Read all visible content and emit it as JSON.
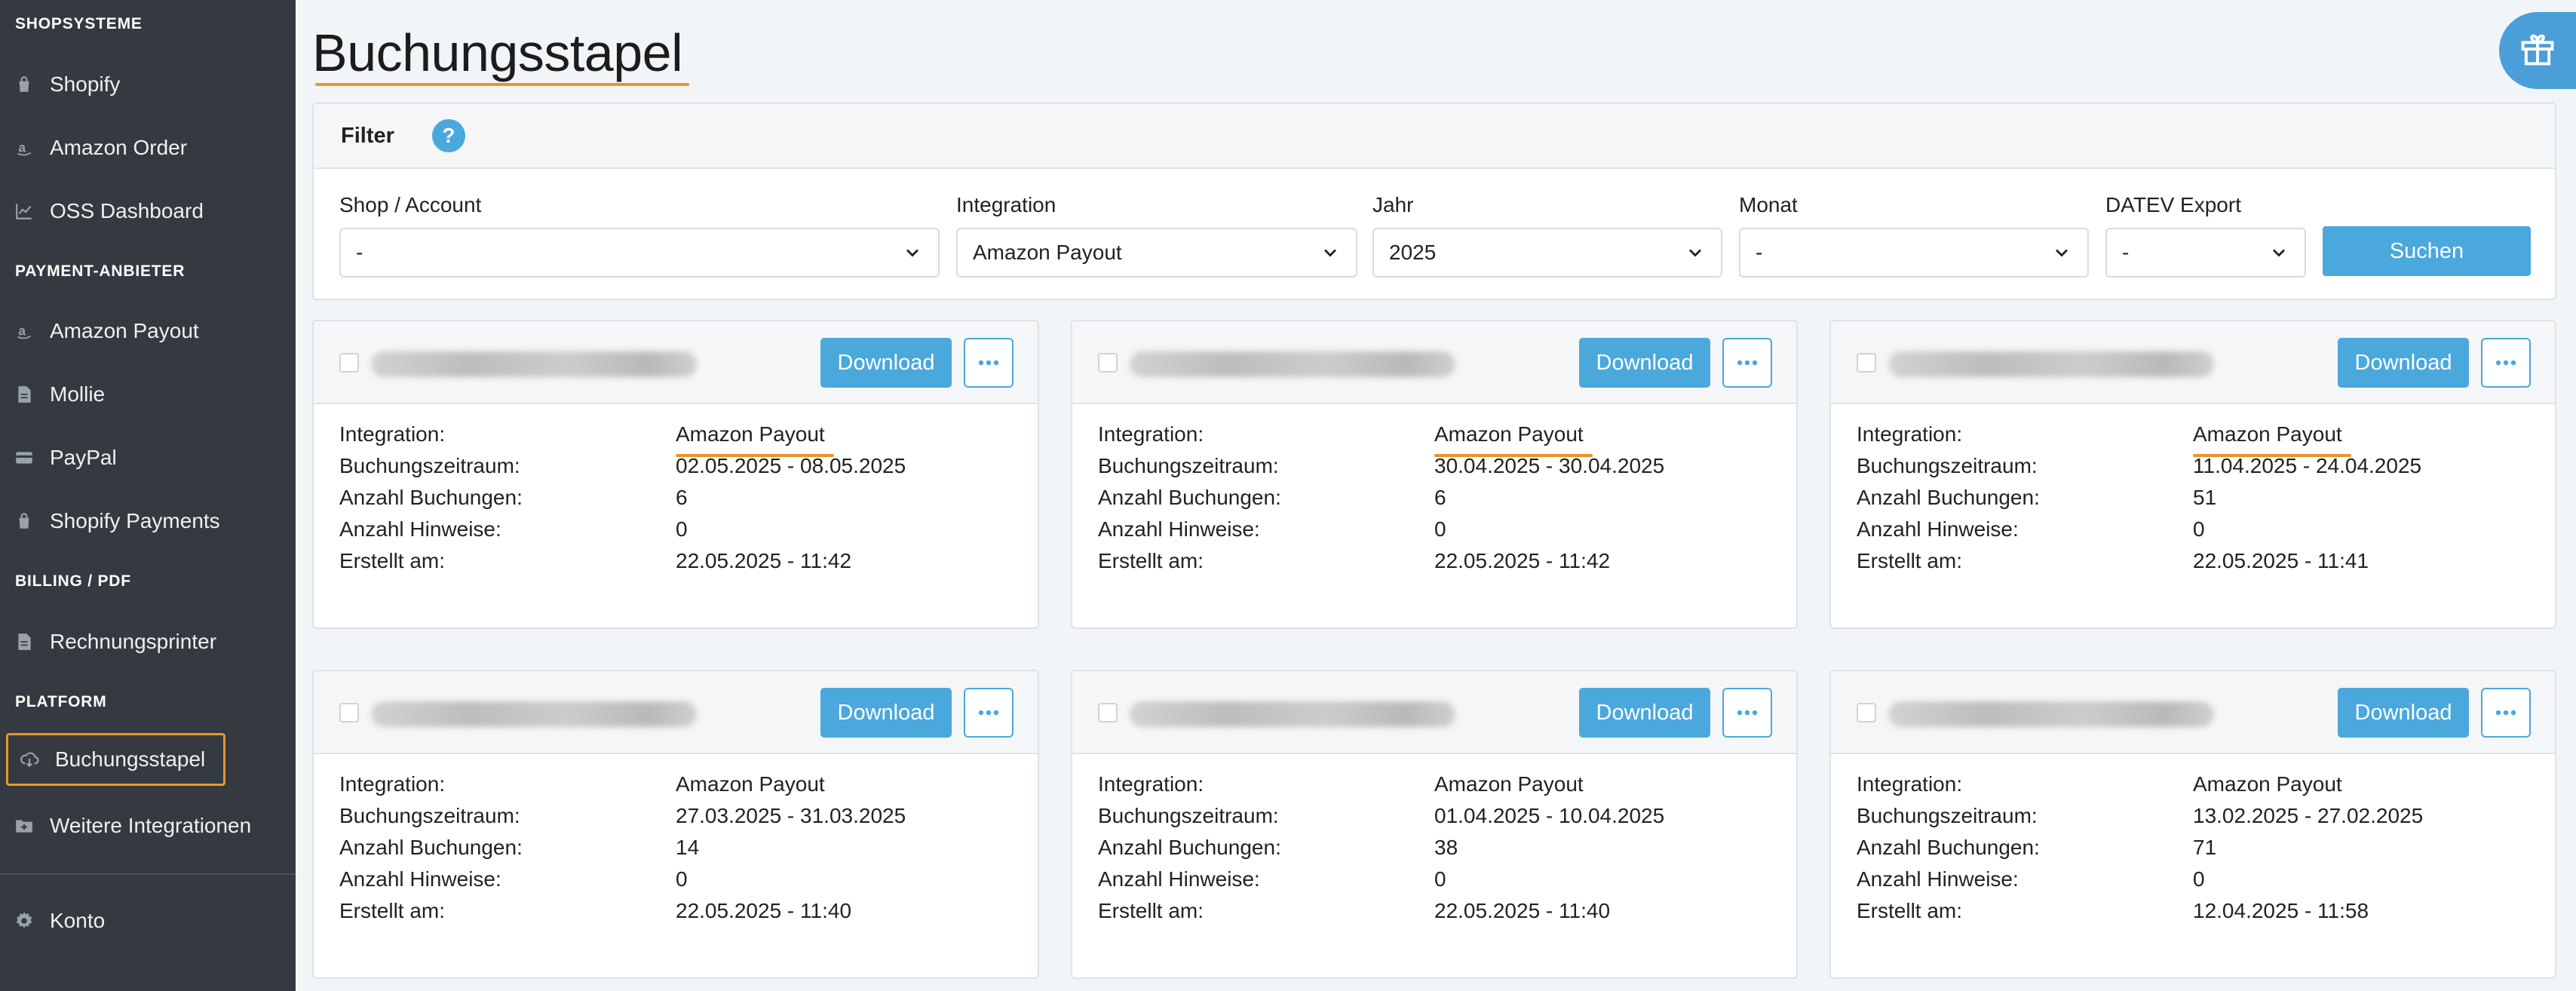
{
  "sidebar": {
    "sections": [
      {
        "title": "SHOPSYSTEME"
      },
      {
        "title": "PAYMENT-ANBIETER"
      },
      {
        "title": "BILLING / PDF"
      },
      {
        "title": "PLATFORM"
      }
    ],
    "items": [
      {
        "label": "Shopify",
        "icon": "bag-icon"
      },
      {
        "label": "Amazon Order",
        "icon": "amazon-icon"
      },
      {
        "label": "OSS Dashboard",
        "icon": "chart-icon"
      },
      {
        "label": "Amazon Payout",
        "icon": "amazon-icon"
      },
      {
        "label": "Mollie",
        "icon": "file-icon"
      },
      {
        "label": "PayPal",
        "icon": "card-icon"
      },
      {
        "label": "Shopify Payments",
        "icon": "bag-icon"
      },
      {
        "label": "Rechnungsprinter",
        "icon": "file-icon"
      },
      {
        "label": "Buchungsstapel",
        "icon": "cloud-download-icon"
      },
      {
        "label": "Weitere Integrationen",
        "icon": "folder-plus-icon"
      },
      {
        "label": "Konto",
        "icon": "gear-icon"
      }
    ]
  },
  "page": {
    "title": "Buchungsstapel"
  },
  "filter": {
    "title": "Filter",
    "help": "?",
    "shop_label": "Shop / Account",
    "shop_value": "-",
    "integration_label": "Integration",
    "integration_value": "Amazon Payout",
    "year_label": "Jahr",
    "year_value": "2025",
    "month_label": "Monat",
    "month_value": "-",
    "datev_label": "DATEV Export",
    "datev_value": "-",
    "search_label": "Suchen"
  },
  "labels": {
    "download": "Download",
    "integration": "Integration:",
    "period": "Buchungszeitraum:",
    "bookings": "Anzahl Buchungen:",
    "notes": "Anzahl Hinweise:",
    "created": "Erstellt am:"
  },
  "cards": [
    {
      "integration": "Amazon Payout",
      "period": "02.05.2025 - 08.05.2025",
      "bookings": "6",
      "notes": "0",
      "created": "22.05.2025 - 11:42"
    },
    {
      "integration": "Amazon Payout",
      "period": "30.04.2025 - 30.04.2025",
      "bookings": "6",
      "notes": "0",
      "created": "22.05.2025 - 11:42"
    },
    {
      "integration": "Amazon Payout",
      "period": "11.04.2025 - 24.04.2025",
      "bookings": "51",
      "notes": "0",
      "created": "22.05.2025 - 11:41"
    },
    {
      "integration": "Amazon Payout",
      "period": "27.03.2025 - 31.03.2025",
      "bookings": "14",
      "notes": "0",
      "created": "22.05.2025 - 11:40"
    },
    {
      "integration": "Amazon Payout",
      "period": "01.04.2025 - 10.04.2025",
      "bookings": "38",
      "notes": "0",
      "created": "22.05.2025 - 11:40"
    },
    {
      "integration": "Amazon Payout",
      "period": "13.02.2025 - 27.02.2025",
      "bookings": "71",
      "notes": "0",
      "created": "12.04.2025 - 11:58"
    }
  ],
  "colors": {
    "accent": "#4aa8dc",
    "highlight": "#e8952b",
    "sidebar": "#343a40"
  }
}
